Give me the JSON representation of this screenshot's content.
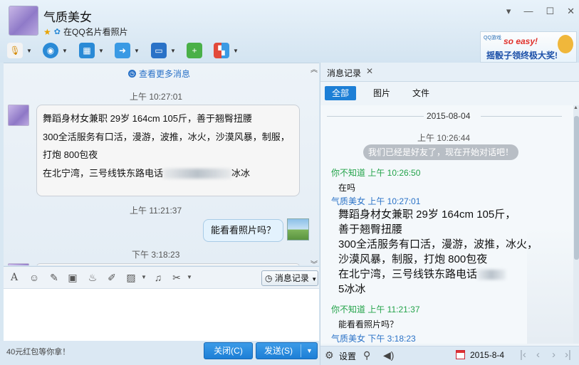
{
  "window": {
    "contact_name": "气质美女",
    "status_text": "在QQ名片看照片",
    "controls": [
      "▾",
      "—",
      "☐",
      "✕"
    ]
  },
  "ad": {
    "logo": "QQ游戏",
    "headline": "so easy!",
    "text": "摇骰子领终极大奖!"
  },
  "chat": {
    "more_messages": "查看更多消息",
    "messages": [
      {
        "time": "上午 10:27:01",
        "lines": [
          "舞蹈身材女兼职  29岁  164cm  105斤，善于翘臀扭腰",
          "300全活服务有口活，漫游，波推，冰火，沙漠风暴，制服，",
          "打炮  800包夜",
          "在北宁湾，三号线铁东路电话",
          "冰冰"
        ]
      },
      {
        "time": "上午 11:21:37",
        "text": "能看看照片吗？"
      },
      {
        "time": "下午 3:18:23"
      }
    ]
  },
  "input_toolbar": {
    "history_button": "消息记录"
  },
  "bottom": {
    "promo": "40元红包等你拿！",
    "close_label": "关闭(C)",
    "send_label": "发送(S)"
  },
  "history": {
    "tab_title": "消息记录",
    "filters": [
      "全部",
      "图片",
      "文件"
    ],
    "date": "2015-08-04",
    "entries": {
      "t1": "上午 10:26:44",
      "system": "我们已经是好友了，现在开始对话吧！",
      "n1": "你不知道 上午 10:26:50",
      "m1": "在吗",
      "n2": "气质美女 上午 10:27:01",
      "big_lines": [
        "舞蹈身材女兼职  29岁  164cm  105斤，",
        "善于翘臀扭腰",
        "300全活服务有口活，漫游，波推，冰火，",
        "沙漠风暴，制服，打炮  800包夜",
        "在北宁湾，三号线铁东路电话",
        "5冰冰"
      ],
      "n3": "你不知道 上午 11:21:37",
      "m3": "能看看照片吗？",
      "n4": "气质美女 下午 3:18:23"
    },
    "settings_label": "设置",
    "date_short": "2015-8-4"
  }
}
